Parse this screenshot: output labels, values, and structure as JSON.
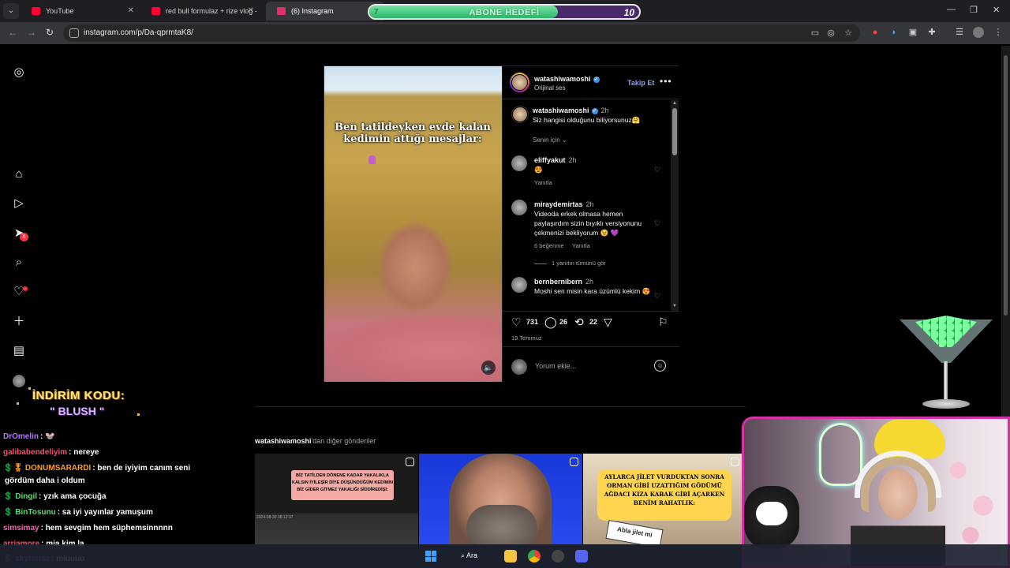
{
  "browser": {
    "tabs": [
      {
        "title": "YouTube",
        "favicon_color": "#ff0033"
      },
      {
        "title": "red bull formulaz + rize vlog - Y",
        "favicon_color": "#ff0033"
      },
      {
        "title": "(6) Instagram",
        "favicon_color": "#e1306c"
      }
    ],
    "url": "instagram.com/p/Da-qprmtaK8/"
  },
  "goal_overlay": {
    "label": "ABONE HEDEFİ",
    "start": "7",
    "target": "10",
    "progress": 0.7
  },
  "instagram": {
    "rail_badge": "6",
    "post": {
      "media_caption": "Ben tatildeyken evde kalan kedimin attığı mesajlar:",
      "author": "watashiwamoshi",
      "audio": "Orijinal ses",
      "follow_label": "Takip Et",
      "caption_user": "watashiwamoshi",
      "caption_time": "2h",
      "caption_text": "Siz hangisi olduğunu biliyorsunuz🤗",
      "sort_label": "Senin için",
      "comments": [
        {
          "user": "eliffyakut",
          "time": "2h",
          "text": "😍",
          "reply": "Yanıtla"
        },
        {
          "user": "miraydemirtas",
          "time": "2h",
          "text": "Videoda erkek olmasa hemen paylaşırdım sizin bıyıklı versiyonunu çekmenizi bekliyorum 😉 💜",
          "likes": "6 beğenme",
          "reply": "Yanıtla",
          "view_replies": "1 yanıtın tümünü gör"
        },
        {
          "user": "bernbernibern",
          "time": "2h",
          "text": "Moshi sen misin kara üzümlü kekim 😍"
        }
      ],
      "counts": {
        "likes": "731",
        "comments": "26",
        "reposts": "22"
      },
      "date": "19 Temmuz",
      "comment_placeholder": "Yorum ekle..."
    },
    "more_posts_user": "watashiwamoshi",
    "more_posts_suffix": "'dan diğer gönderiler",
    "thumbs": [
      {
        "text": "BİZ TATİLDEN DÖNENE KADAR YAKALIKLA KALSIN İYİLEŞİR DİYE DÜŞÜNDÜĞÜM KEDİMİN BİZ GİDER GİTMEZ YAKALIĞI SİDDİREDİŞİ:",
        "timestamp": "2024-08-30 08:12:37"
      },
      {
        "text": ""
      },
      {
        "text": "AYLARCA JİLET VURDUKTAN SONRA ORMAN GİBİ UZATTIĞIM GÖDÜMÜ AĞDACI KIZA KABAK GİBİ AÇARKEN BENİM RAHATLIK:",
        "sign": "Abla jilet mi"
      }
    ]
  },
  "stream": {
    "promo_line1": "İNDİRİM KODU:",
    "promo_line2": "\" BLUSH \"",
    "chat": [
      {
        "user": "DrOmelin",
        "text": ": 🐭",
        "color": "#b574ff"
      },
      {
        "user": "galibabendeliyim",
        "text": ": nereye",
        "color": "#ff4d6a"
      },
      {
        "user": "💲🎖 DONUMSARARDI",
        "text": ": ben de iyiyim canım seni",
        "color": "#ff9f1a"
      },
      {
        "user": "",
        "text": "gördüm daha i oldum",
        "color": "#ffffff"
      },
      {
        "user": "💲 Dingil",
        "text": ": yzık ama çocuğa",
        "color": "#51e06b"
      },
      {
        "user": "💲 BinTosunu",
        "text": ": sa iyi yayınlar yamuşum",
        "color": "#51e06b"
      },
      {
        "user": "simsimay",
        "text": ": hem sevgim hem süphemsinnnnn",
        "color": "#ff5fb4"
      },
      {
        "user": "arriamore",
        "text": ": mia kim la",
        "color": "#ff4d6a"
      },
      {
        "user": "💲 skytorise",
        "text": ": miuuuu",
        "color": "#e36bff"
      }
    ]
  },
  "taskbar": {
    "search_label": "Ara"
  }
}
